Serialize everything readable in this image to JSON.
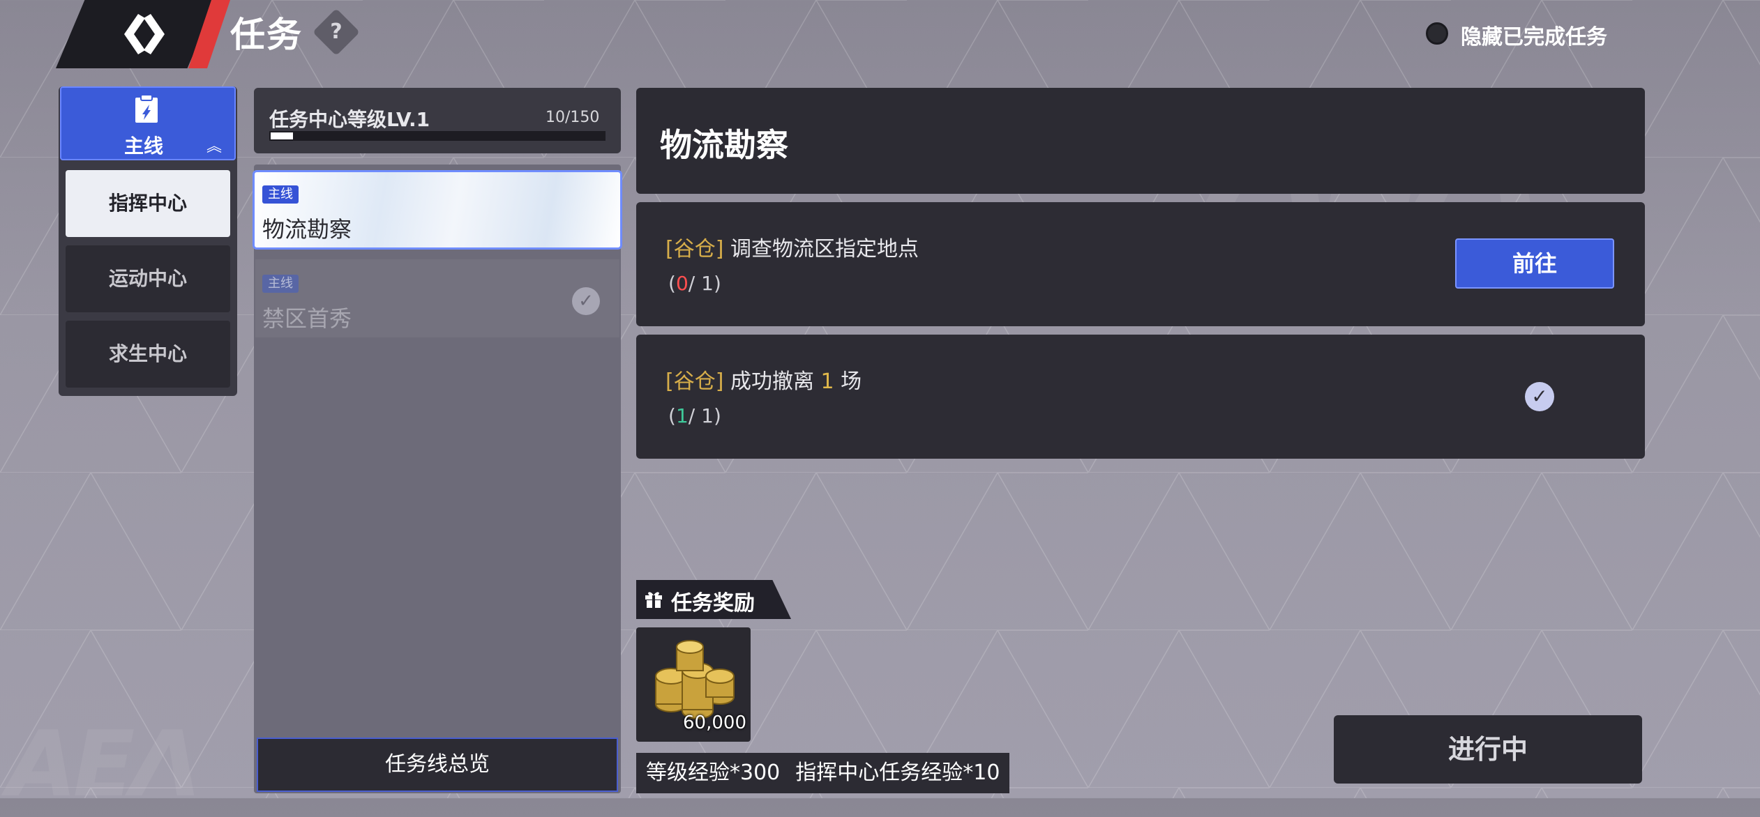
{
  "header": {
    "title": "任务",
    "help_symbol": "?",
    "hide_completed_label": "隐藏已完成任务"
  },
  "nav": {
    "main_label": "主线",
    "items": [
      {
        "label": "指挥中心",
        "active": true
      },
      {
        "label": "运动中心",
        "active": false
      },
      {
        "label": "求生中心",
        "active": false
      }
    ]
  },
  "level": {
    "label": "任务中心等级LV.1",
    "count": "10/150",
    "progress": 0.067
  },
  "quests": [
    {
      "tag": "主线",
      "title": "物流勘察",
      "selected": true,
      "completed": false
    },
    {
      "tag": "主线",
      "title": "禁区首秀",
      "selected": false,
      "completed": true
    }
  ],
  "overview_label": "任务线总览",
  "detail": {
    "title": "物流勘察",
    "objectives": [
      {
        "category": "[谷仓]",
        "text": "调查物流区指定地点",
        "current": "0",
        "sep": "/",
        "total": "1",
        "open": "(",
        "close": ")",
        "action": "前往"
      },
      {
        "category": "[谷仓]",
        "text_before": "成功撤离",
        "number": "1",
        "text_after": "场",
        "current": "1",
        "sep": "/",
        "total": "1",
        "open": "(",
        "close": ")"
      }
    ]
  },
  "rewards": {
    "label": "任务奖励",
    "item_count": "60,000",
    "exp": [
      "等级经验*300",
      "指挥中心任务经验*10"
    ]
  },
  "status_label": "进行中",
  "watermark": "AEΛ",
  "colors": {
    "accent_blue": "#3b5bd9",
    "accent_red": "#e03a3a",
    "gold": "#d7ae4a"
  }
}
